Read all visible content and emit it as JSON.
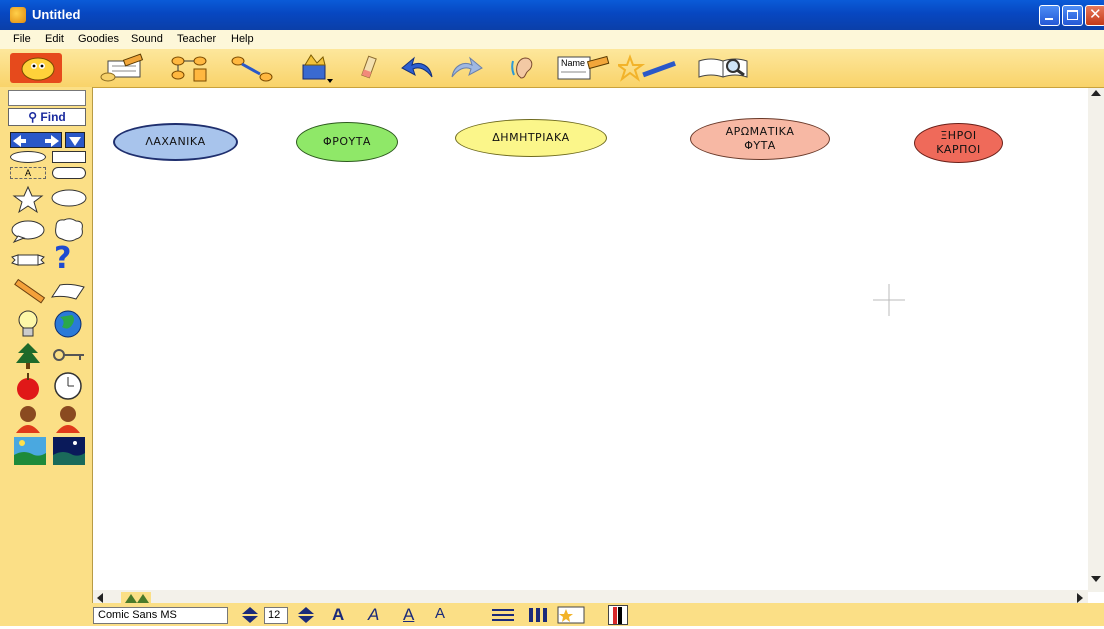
{
  "window": {
    "title": "Untitled"
  },
  "menu": [
    "File",
    "Edit",
    "Goodies",
    "Sound",
    "Teacher",
    "Help"
  ],
  "toolbar": {
    "icons": [
      "kidspiration-mascot-icon",
      "picture-view-icon",
      "outline-view-icon",
      "link-tool-icon",
      "symbol-library-icon",
      "eraser-icon",
      "undo-icon",
      "redo-icon",
      "listen-icon",
      "name-tag-icon",
      "magic-wand-icon",
      "paint-icon",
      "book-search-icon"
    ],
    "name_tag_label": "Name"
  },
  "palette": {
    "find_value": "",
    "find_label": "Find",
    "text_shape_label": "A"
  },
  "canvas": {
    "nodes": [
      {
        "label": "ΛΑΧΑΝΙΚΑ",
        "fill": "#a8c4ec",
        "border": "#1f2f6e"
      },
      {
        "label": "ΦΡΟΥΤΑ",
        "fill": "#8fe868",
        "border": "#2d5a1e"
      },
      {
        "label": "ΔΗΜΗΤΡΙΑΚΑ",
        "fill": "#fbf68a",
        "border": "#6e6a1e"
      },
      {
        "label1": "ΑΡΩΜΑΤΙΚΑ",
        "label2": "ΦΥΤΑ",
        "fill": "#f7b8a4",
        "border": "#6a3a2a"
      },
      {
        "label1": "ΞΗΡΟΙ",
        "label2": "ΚΑΡΠΟΙ",
        "fill": "#ef6a5a",
        "border": "#6a1f18"
      }
    ]
  },
  "format_bar": {
    "font": "Comic Sans MS",
    "size": "12"
  }
}
